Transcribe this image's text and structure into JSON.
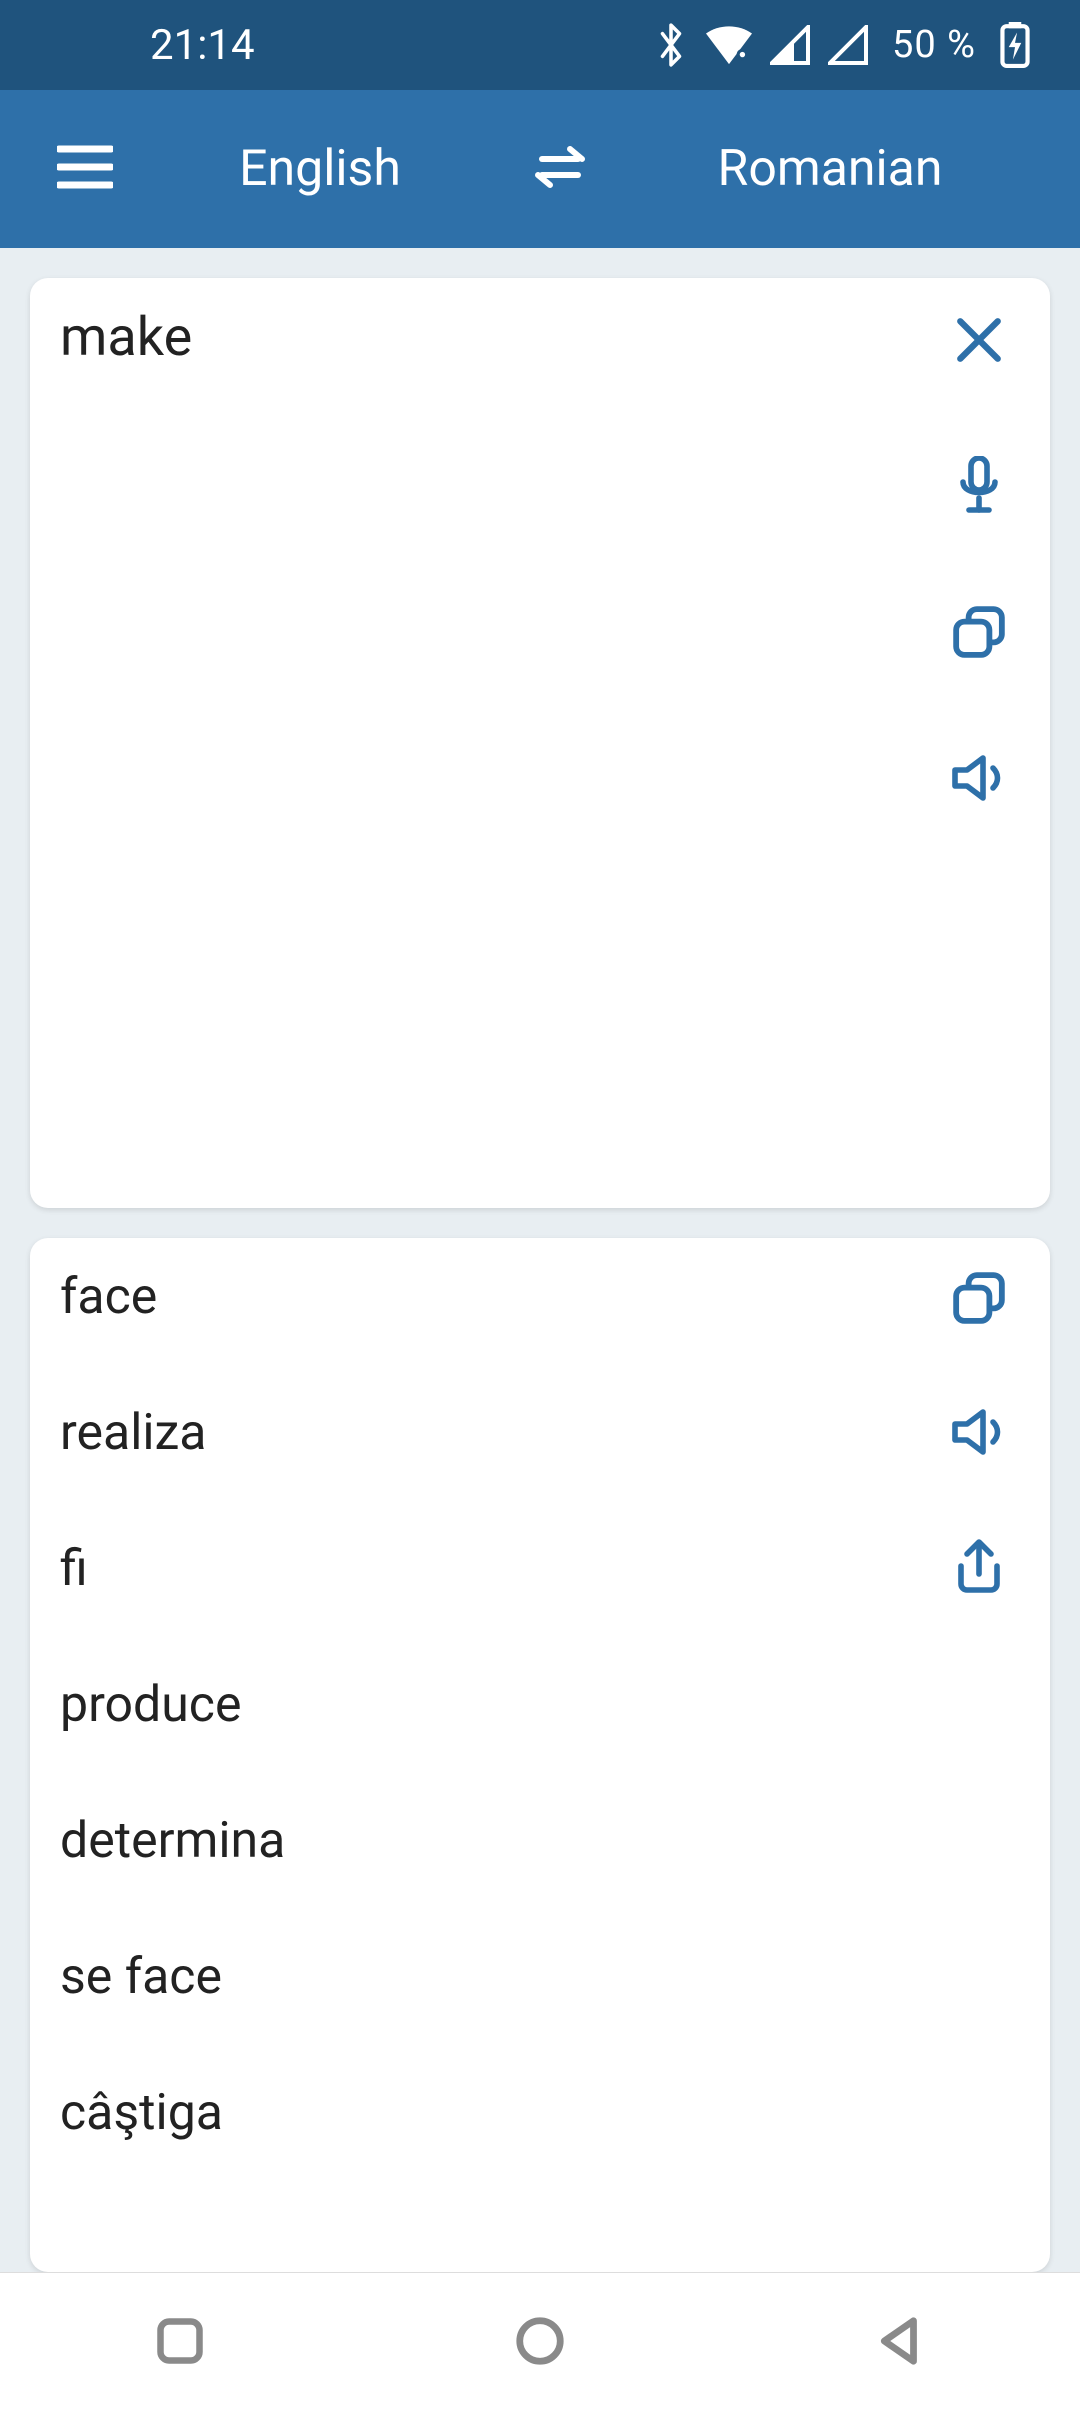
{
  "status": {
    "time": "21:14",
    "battery": "50 %"
  },
  "appbar": {
    "source_lang": "English",
    "target_lang": "Romanian"
  },
  "input": {
    "text": "make"
  },
  "results": [
    "face",
    "realiza",
    "fi",
    "produce",
    "determina",
    "se face",
    "câştiga"
  ]
}
